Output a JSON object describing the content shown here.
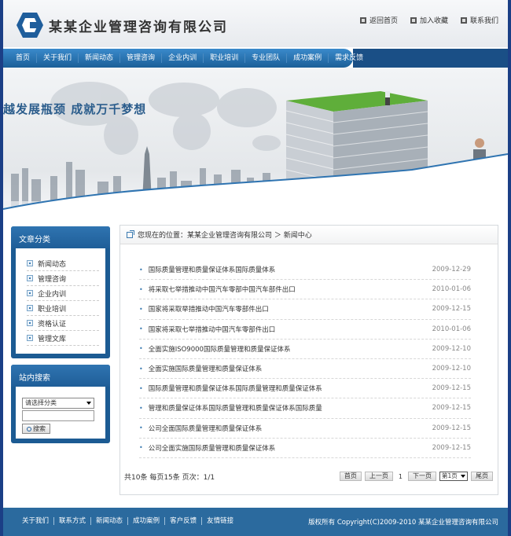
{
  "header": {
    "company": "某某企业管理咨询有限公司",
    "links": [
      "返回首页",
      "加入收藏",
      "联系我们"
    ]
  },
  "nav": [
    "首页",
    "关于我们",
    "新闻动态",
    "管理咨询",
    "企业内训",
    "职业培训",
    "专业团队",
    "成功案例",
    "需求反馈"
  ],
  "banner": {
    "slogan": "越发展瓶颈 成就万千梦想"
  },
  "sidebar": {
    "categories_title": "文章分类",
    "categories": [
      "新闻动态",
      "管理咨询",
      "企业内训",
      "职业培训",
      "资格认证",
      "管理文库"
    ],
    "search_title": "站内搜索",
    "search_select": "请选择分类",
    "search_button": "搜索"
  },
  "breadcrumb": {
    "prefix": "您现在的位置：",
    "path": "某某企业管理咨询有限公司 ＞ 新闻中心"
  },
  "news": [
    {
      "title": "国际质量管理和质量保证体系国际质量体系",
      "date": "2009-12-29"
    },
    {
      "title": "将采取七举措推动中国汽车零部中国汽车部件出口",
      "date": "2010-01-06"
    },
    {
      "title": "国家将采取举措推动中国汽车零部件出口",
      "date": "2009-12-15"
    },
    {
      "title": "国家将采取七举措推动中国汽车零部件出口",
      "date": "2010-01-06"
    },
    {
      "title": "全面实施ISO9000国际质量管理和质量保证体系",
      "date": "2009-12-10"
    },
    {
      "title": "全面实施国际质量管理和质量保证体系",
      "date": "2009-12-10"
    },
    {
      "title": "国际质量管理和质量保证体系国际质量管理和质量保证体系",
      "date": "2009-12-15"
    },
    {
      "title": "管理和质量保证体系国际质量管理和质量保证体系国际质量",
      "date": "2009-12-15"
    },
    {
      "title": "公司全面国际质量管理和质量保证体系",
      "date": "2009-12-15"
    },
    {
      "title": "公司全面实施国际质量管理和质量保证体系",
      "date": "2009-12-15"
    }
  ],
  "pagination": {
    "info": "共10条  每页15条  页次：1/1",
    "first": "首页",
    "prev": "上一页",
    "current": "1",
    "next": "下一页",
    "select": "第1页",
    "last": "尾页"
  },
  "footer": {
    "links": [
      "关于我们",
      "联系方式",
      "新闻动态",
      "成功案例",
      "客户反馈",
      "友情链接"
    ],
    "copyright": "版权所有  Copyright(C)2009-2010 某某企业管理咨询有限公司"
  },
  "colors": {
    "primary": "#1c5b93",
    "page_bg": "#1b3f86",
    "footer": "#2b6a9e"
  }
}
